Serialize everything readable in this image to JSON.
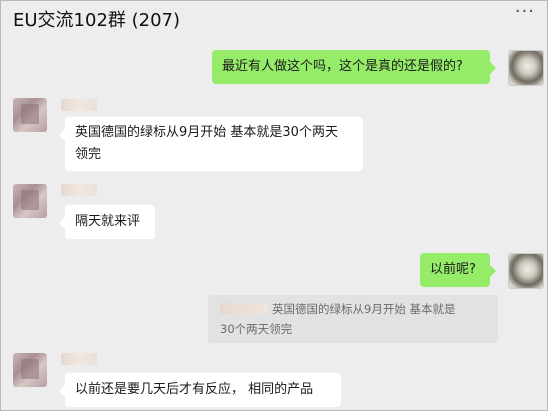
{
  "chat": {
    "title": "EU交流102群 (207)",
    "more_icon": "···"
  },
  "messages": [
    {
      "side": "right",
      "text": "最近有人做这个吗，这个是真的还是假的?"
    },
    {
      "side": "left",
      "text_line1": "英国德国的绿标从9月开始 基本就是30个两天",
      "text_line2": "领完"
    },
    {
      "side": "left",
      "text": "隔天就来评"
    },
    {
      "side": "right",
      "text": "以前呢?"
    },
    {
      "side": "left",
      "text": "以前还是要几天后才有反应， 相同的产品"
    }
  ],
  "quote": {
    "line1": "英国德国的绿标从9月开始 基本就是",
    "line2": "30个两天领完"
  },
  "colors": {
    "background": "#ededed",
    "bubble_self": "#95ec69",
    "bubble_other": "#ffffff",
    "quote_bg": "#e2e2e2"
  }
}
